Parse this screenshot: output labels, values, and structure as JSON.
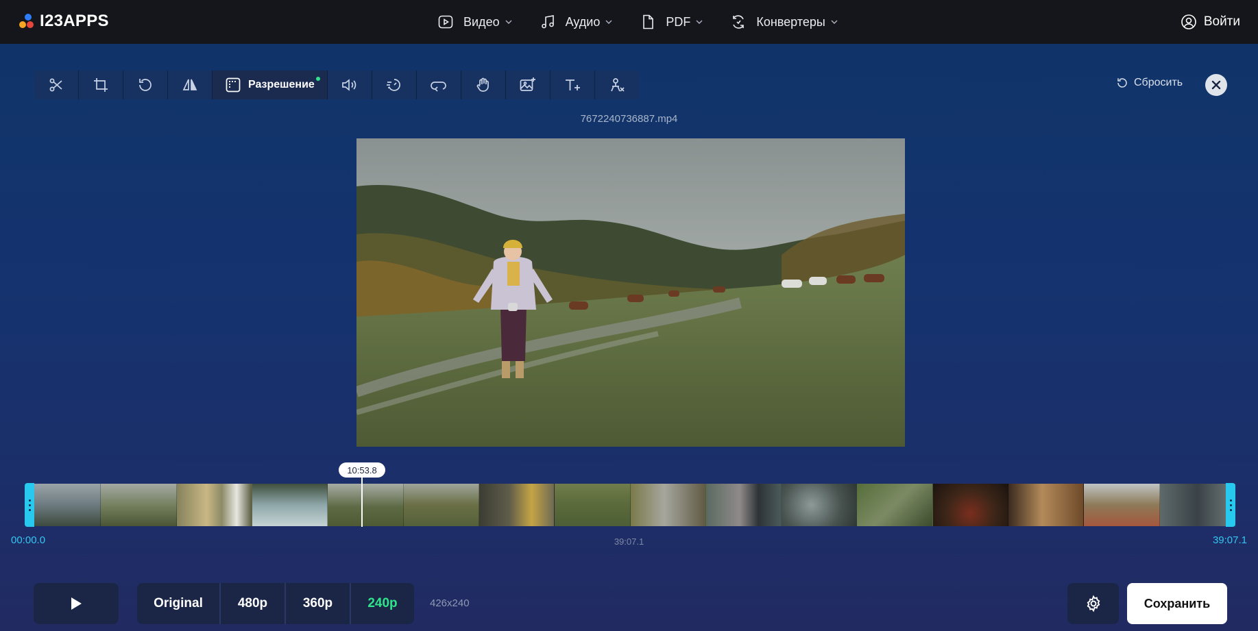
{
  "header": {
    "logo_text": "I23APPS",
    "logo_colors": [
      "#f5a623",
      "#e8453c",
      "#2f7df6"
    ],
    "nav": [
      {
        "label": "Видео",
        "icon": "play-square-icon"
      },
      {
        "label": "Аудио",
        "icon": "music-note-icon"
      },
      {
        "label": "PDF",
        "icon": "document-icon"
      },
      {
        "label": "Конвертеры",
        "icon": "convert-icon"
      }
    ],
    "login_label": "Войти"
  },
  "toolbar": {
    "tools": [
      {
        "name": "cut",
        "icon": "scissors-icon"
      },
      {
        "name": "crop",
        "icon": "crop-icon"
      },
      {
        "name": "rotate",
        "icon": "rotate-icon"
      },
      {
        "name": "flip",
        "icon": "flip-icon"
      },
      {
        "name": "resolution",
        "icon": "resolution-icon",
        "label": "Разрешение",
        "active": true
      },
      {
        "name": "volume",
        "icon": "volume-icon"
      },
      {
        "name": "speed",
        "icon": "speed-icon"
      },
      {
        "name": "loop",
        "icon": "loop-icon"
      },
      {
        "name": "stabilize",
        "icon": "hand-icon"
      },
      {
        "name": "image",
        "icon": "add-image-icon"
      },
      {
        "name": "text",
        "icon": "add-text-icon"
      },
      {
        "name": "remove-logo",
        "icon": "remove-logo-icon"
      }
    ],
    "reset_label": "Сбросить"
  },
  "filename": "7672240736887.mp4",
  "timeline": {
    "playhead_time": "10:53.8",
    "start_time": "00:00.0",
    "end_time": "39:07.1",
    "duration": "39:07.1",
    "playhead_fraction": 0.278
  },
  "controls": {
    "resolutions": [
      "Original",
      "480p",
      "360p",
      "240p"
    ],
    "selected_resolution": "240p",
    "dimensions": "426x240",
    "save_label": "Сохранить"
  },
  "colors": {
    "accent_green": "#2fe38b",
    "handle_cyan": "#27c9ef",
    "topbar": "#15161b"
  }
}
